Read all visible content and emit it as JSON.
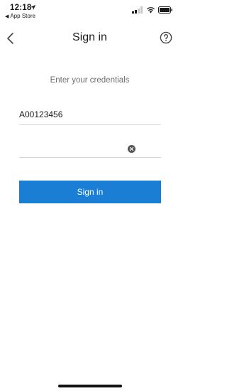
{
  "status": {
    "time": "12:18",
    "back_label": "App Store"
  },
  "nav": {
    "title": "Sign in"
  },
  "form": {
    "subtitle": "Enter your credentials",
    "username_value": "A00123456",
    "password_value": "",
    "submit_label": "Sign in"
  },
  "colors": {
    "accent": "#1a7fd4",
    "subtitle": "#6e6e6e",
    "divider": "#d8d8d8"
  },
  "icons": [
    "location-icon",
    "back-caret-icon",
    "signal-icon",
    "wifi-icon",
    "battery-icon",
    "chevron-left-icon",
    "help-icon",
    "clear-icon"
  ]
}
